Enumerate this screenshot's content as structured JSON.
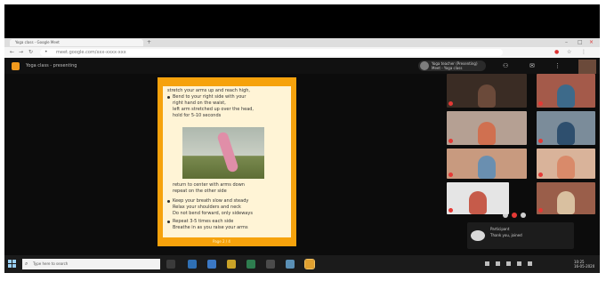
{
  "browser": {
    "tab_title": "Yoga class - Google Meet",
    "url": "meet.google.com",
    "url_full": "meet.google.com/xxx-xxxx-xxx"
  },
  "meeting": {
    "title": "Yoga class - presenting",
    "presenter_name": "Yoga teacher (Presenting)",
    "presenter_sub": "Meet - Yoga class",
    "accent_color": "#f6a20c"
  },
  "document": {
    "lines": [
      "stretch your arms up and reach high,",
      "Bend to your right side with your",
      "right hand on the waist,",
      "left arm stretched up over the head,",
      "hold for 5-10 seconds"
    ],
    "caption_lines": [
      "return to center with arms down",
      "repeat on the other side"
    ],
    "bottom_lines": [
      "Keep your breath slow and steady",
      "Relax your shoulders and neck",
      "Do not bend forward, only sideways",
      "Repeat 3-5 times each side",
      "Breathe in as you raise your arms"
    ],
    "page_indicator": "Page 2 / 4"
  },
  "participants": [
    {
      "id": "p1",
      "bg": "#3a2c24",
      "person": "#6b4a3a"
    },
    {
      "id": "p2",
      "bg": "#a45a4a",
      "person": "#3d6a8a"
    },
    {
      "id": "p3",
      "bg": "#b5a093",
      "person": "#d07050"
    },
    {
      "id": "p4",
      "bg": "#7b8c9a",
      "person": "#2e4f6e"
    },
    {
      "id": "p5",
      "bg": "#c89a7f",
      "person": "#6a8fb0"
    },
    {
      "id": "p6",
      "bg": "#d9b39a",
      "person": "#d98a6a"
    },
    {
      "id": "p7",
      "bg": "#e5e5e5",
      "person": "#c65b4a"
    },
    {
      "id": "p8",
      "bg": "#9a5e4a",
      "person": "#d9c0a0"
    }
  ],
  "chat": {
    "sender": "Participant",
    "message": "Thank you, joined"
  },
  "taskbar": {
    "search_placeholder": "Type here to search",
    "time": "10:25",
    "date": "16-05-2020"
  }
}
